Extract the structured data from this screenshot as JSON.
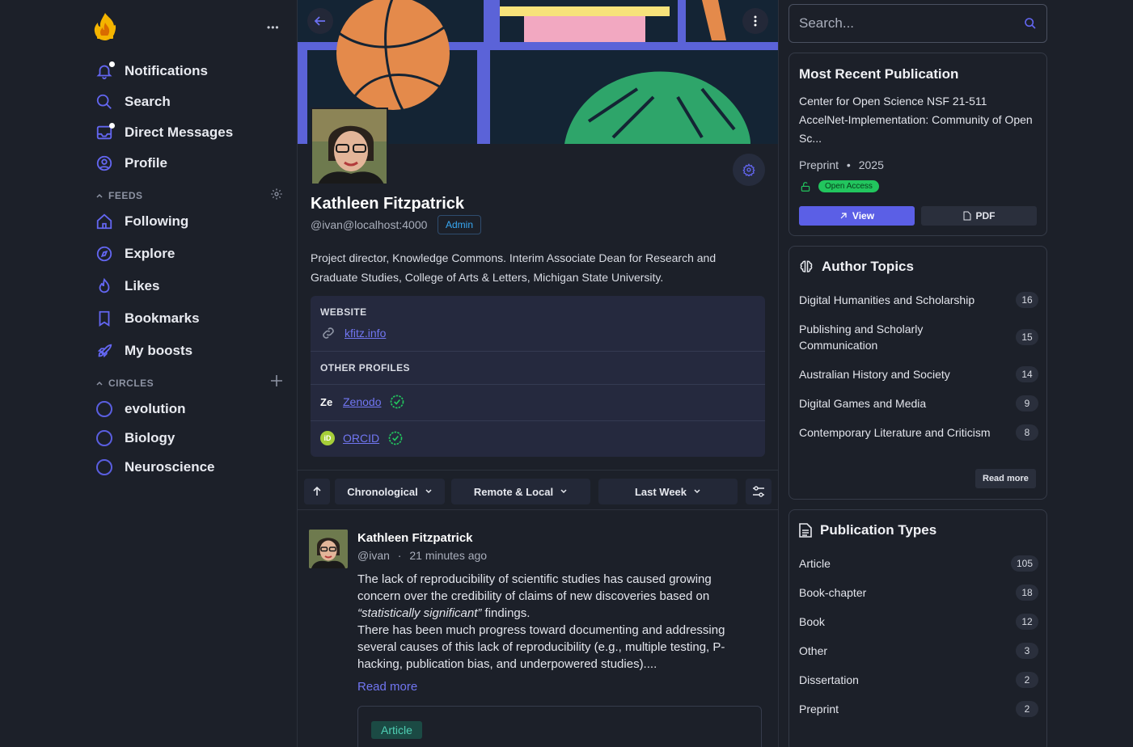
{
  "sidebar": {
    "more_label": "•••",
    "nav": [
      {
        "label": "Notifications"
      },
      {
        "label": "Search"
      },
      {
        "label": "Direct Messages"
      },
      {
        "label": "Profile"
      }
    ],
    "feeds_header": "FEEDS",
    "feeds": [
      {
        "label": "Following"
      },
      {
        "label": "Explore"
      },
      {
        "label": "Likes"
      },
      {
        "label": "Bookmarks"
      },
      {
        "label": "My boosts"
      }
    ],
    "circles_header": "CIRCLES",
    "circles": [
      {
        "label": "evolution"
      },
      {
        "label": "Biology"
      },
      {
        "label": "Neuroscience"
      }
    ]
  },
  "profile": {
    "name": "Kathleen Fitzpatrick",
    "handle": "@ivan@localhost:4000",
    "role_badge": "Admin",
    "bio": "Project director, Knowledge Commons. Interim Associate Dean for Research and Graduate Studies, College of Arts & Letters, Michigan State University.",
    "website_label": "WEBSITE",
    "website": "kfitz.info",
    "other_profiles_label": "OTHER PROFILES",
    "other_profiles": [
      {
        "name": "Zenodo",
        "icon_text": "Ze"
      },
      {
        "name": "ORCID",
        "icon_text": "iD"
      }
    ]
  },
  "filters": {
    "sort": "Chronological",
    "scope": "Remote & Local",
    "time": "Last Week"
  },
  "post": {
    "author": "Kathleen Fitzpatrick",
    "handle": "@ivan",
    "time": "21 minutes ago",
    "body_1": "The lack of reproducibility of scientific studies has caused growing concern over the credibility of claims of new discoveries based on",
    "body_em": "“statistically significant”",
    "body_2": " findings.",
    "body_3": "There has been much progress toward documenting and addressing several causes of this lack of reproducibility (e.g., multiple testing, P-hacking, publication bias, and underpowered studies)....",
    "read_more": "Read more",
    "tag": "Article"
  },
  "right": {
    "search_placeholder": "Search...",
    "recent": {
      "title": "Most Recent Publication",
      "pub_title": "Center for Open Science NSF 21-511 AccelNet-Implementation: Community of Open Sc...",
      "type": "Preprint",
      "sep": "•",
      "year": "2025",
      "badge": "Open Access",
      "view": "View",
      "pdf": "PDF"
    },
    "topics": {
      "title": "Author Topics",
      "items": [
        {
          "name": "Digital Humanities and Scholarship",
          "count": "16"
        },
        {
          "name": "Publishing and Scholarly Communication",
          "count": "15"
        },
        {
          "name": "Australian History and Society",
          "count": "14"
        },
        {
          "name": "Digital Games and Media",
          "count": "9"
        },
        {
          "name": "Contemporary Literature and Criticism",
          "count": "8"
        }
      ],
      "read_more": "Read more"
    },
    "pub_types": {
      "title": "Publication Types",
      "items": [
        {
          "name": "Article",
          "count": "105"
        },
        {
          "name": "Book-chapter",
          "count": "18"
        },
        {
          "name": "Book",
          "count": "12"
        },
        {
          "name": "Other",
          "count": "3"
        },
        {
          "name": "Dissertation",
          "count": "2"
        },
        {
          "name": "Preprint",
          "count": "2"
        }
      ]
    }
  },
  "colors": {
    "background": "#1c2029",
    "accent": "#5b5fe6",
    "link": "#7176f2",
    "success": "#22c55e"
  }
}
